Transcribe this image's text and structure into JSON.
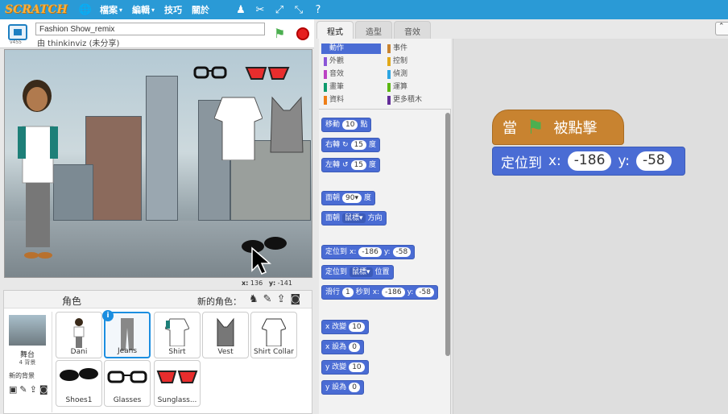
{
  "app": {
    "logo": "SCRATCH"
  },
  "menu": {
    "file": "檔案",
    "edit": "編輯",
    "tips": "技巧",
    "about": "關於",
    "chev": "▾"
  },
  "stage_header": {
    "project_title": "Fashion Show_remix",
    "byline": "由 thinkinviz (未分享)",
    "version": "v455"
  },
  "stage": {
    "coords_x_label": "x:",
    "coords_x": "136",
    "coords_y_label": "y:",
    "coords_y": "-141"
  },
  "sprites": {
    "title": "角色",
    "new_sprite_label": "新的角色：",
    "stage_label": "舞台",
    "stage_count": "4 背景",
    "new_backdrop": "新的背景",
    "items": [
      {
        "label": "Dani",
        "icon": "person"
      },
      {
        "label": "Jeans",
        "icon": "jeans",
        "selected": true
      },
      {
        "label": "Shirt",
        "icon": "shirt"
      },
      {
        "label": "Vest",
        "icon": "vest"
      },
      {
        "label": "Shirt Collar",
        "icon": "collar"
      },
      {
        "label": "Shoes1",
        "icon": "shoes"
      },
      {
        "label": "Glasses",
        "icon": "glasses"
      },
      {
        "label": "Sunglass...",
        "icon": "sunglasses"
      }
    ]
  },
  "tabs": {
    "scripts": "程式",
    "costumes": "造型",
    "sounds": "音效"
  },
  "sort_label": "⌃",
  "categories": {
    "motion": "動作",
    "looks": "外觀",
    "sound": "音效",
    "pen": "畫筆",
    "data": "資料",
    "events": "事件",
    "control": "控制",
    "sensing": "偵測",
    "operators": "運算",
    "more": "更多積木"
  },
  "colors": {
    "motion": "#4a6cd4",
    "looks": "#8a55d7",
    "sound": "#bb42c3",
    "pen": "#0e9a6c",
    "data": "#ee7d16",
    "events": "#c88330",
    "control": "#e1a91a",
    "sensing": "#2ca5e2",
    "operators": "#5cb712",
    "more": "#632d99"
  },
  "blocks": {
    "move": {
      "text": "移動",
      "value": "10",
      "suffix": "點"
    },
    "turn_right": {
      "text": "右轉",
      "value": "15",
      "suffix": "度"
    },
    "turn_left": {
      "text": "左轉",
      "value": "15",
      "suffix": "度"
    },
    "point_dir": {
      "text": "面朝",
      "value": "90▾",
      "suffix": "度"
    },
    "point_toward": {
      "text": "面朝",
      "value": "鼠標▾",
      "suffix": "方向"
    },
    "goto_xy": {
      "text": "定位到",
      "x_label": "x:",
      "x": "-186",
      "y_label": "y:",
      "y": "-58"
    },
    "goto": {
      "text": "定位到",
      "value": "鼠標▾",
      "suffix": "位置"
    },
    "glide": {
      "text": "滑行",
      "value": "1",
      "mid": "秒到",
      "x_label": "x:",
      "x": "-186",
      "y_label": "y:",
      "y": "-58"
    },
    "change_x": {
      "text": "x 改變",
      "value": "10"
    },
    "set_x": {
      "text": "x 設為",
      "value": "0"
    },
    "change_y": {
      "text": "y 改變",
      "value": "10"
    },
    "set_y": {
      "text": "y 設為",
      "value": "0"
    }
  },
  "script": {
    "hat_prefix": "當",
    "hat_suffix": "被點擊",
    "goto_text": "定位到",
    "x_label": "x:",
    "x": "-186",
    "y_label": "y:",
    "y": "-58"
  }
}
